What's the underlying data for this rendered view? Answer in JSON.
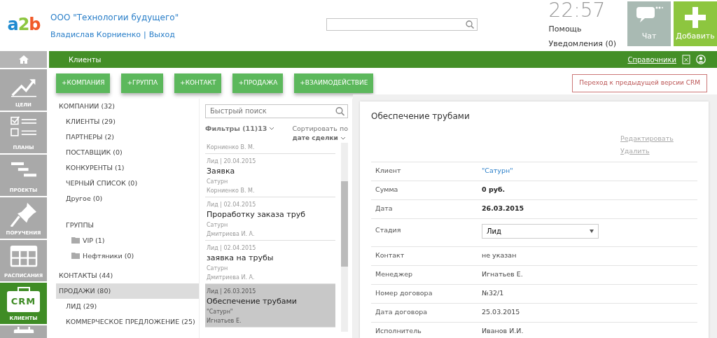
{
  "header": {
    "logo": "a2b",
    "company": "ООО \"Технологии будущего\"",
    "user": "Владислав Корниенко",
    "separator": "|",
    "logout": "Выход",
    "time": "22:57",
    "help": "Помощь",
    "notifications": "Уведомления (0)",
    "chat": "Чат",
    "add": "Добавить"
  },
  "navbar": {
    "title": "Клиенты",
    "directories": "Справочники"
  },
  "rail": [
    {
      "kind": "goals",
      "label": "ЦЕЛИ",
      "selected": false
    },
    {
      "kind": "plans",
      "label": "ПЛАНЫ",
      "selected": false
    },
    {
      "kind": "projects",
      "label": "ПРОЕКТЫ",
      "selected": false
    },
    {
      "kind": "tasks",
      "label": "ПОРУЧЕНИЯ",
      "selected": false
    },
    {
      "kind": "schedule",
      "label": "РАСПИСАНИЯ",
      "selected": false
    },
    {
      "kind": "crm",
      "label": "КЛИЕНТЫ",
      "badge": "CRM",
      "selected": true
    },
    {
      "kind": "calendar",
      "selected": false
    }
  ],
  "actions": [
    "+КОМПАНИЯ",
    "+ГРУППА",
    "+КОНТАКТ",
    "+ПРОДАЖА",
    "+ВЗАИМОДЕЙСТВИЕ"
  ],
  "old_version": "Переход к предыдущей версии CRM",
  "tree": [
    {
      "kind": "section",
      "label": "КОМПАНИИ (32)",
      "selected": false
    },
    {
      "kind": "item",
      "label": "КЛИЕНТЫ (29)",
      "selected": false
    },
    {
      "kind": "item",
      "label": "ПАРТНЕРЫ (2)",
      "selected": false
    },
    {
      "kind": "item",
      "label": "ПОСТАВЩИК (0)",
      "selected": false
    },
    {
      "kind": "item",
      "label": "КОНКУРЕНТЫ (1)",
      "selected": false
    },
    {
      "kind": "item",
      "label": "ЧЕРНЫЙ СПИСОК (0)",
      "selected": false
    },
    {
      "kind": "item",
      "label": "Другое (0)",
      "selected": false
    },
    {
      "kind": "group-heading",
      "label": "ГРУППЫ",
      "selected": false
    },
    {
      "kind": "folder",
      "label": "VIP (1)",
      "selected": false
    },
    {
      "kind": "folder",
      "label": "Нефтяники (0)",
      "selected": false
    },
    {
      "kind": "section",
      "label": "КОНТАКТЫ (44)",
      "selected": false
    },
    {
      "kind": "section",
      "label": "ПРОДАЖИ (80)",
      "selected": true
    },
    {
      "kind": "item",
      "label": "ЛИД (29)",
      "selected": false
    },
    {
      "kind": "item",
      "label": "КОММЕРЧЕСКОЕ ПРЕДЛОЖЕНИЕ (25)",
      "selected": false
    }
  ],
  "deals": {
    "search": {
      "placeholder": "Быстрый поиск"
    },
    "filters": "Фильтры (11)13",
    "sort_label": "Сортировать по",
    "sort_value": "дате сделки",
    "partial_top": "Корниенко В. М.",
    "items": [
      {
        "meta": "Лид | 20.04.2015",
        "title": "Заявка",
        "client": "Сатурн",
        "manager": "Корниенко В. М.",
        "selected": false
      },
      {
        "meta": "Лид | 02.04.2015",
        "title": "Проработку заказа труб",
        "client": "Сатурн",
        "manager": "Дмитриева И. А.",
        "selected": false
      },
      {
        "meta": "Лид | 02.04.2015",
        "title": "заявка на трубы",
        "client": "Сатурн",
        "manager": "Дмитриева И. А.",
        "selected": false
      },
      {
        "meta": "Лид | 26.03.2015",
        "title": "Обеспечение трубами",
        "client": "\"Сатурн\"",
        "manager": "Игнатьев Е.",
        "selected": true
      }
    ]
  },
  "detail": {
    "title": "Обеспечение трубами",
    "edit": "Редактировать",
    "delete": "Удалить",
    "rows": [
      {
        "kind": "link",
        "label": "Клиент",
        "value": "\"Сатурн\""
      },
      {
        "kind": "bold",
        "label": "Сумма",
        "value": "0 руб."
      },
      {
        "kind": "bold",
        "label": "Дата",
        "value": "26.03.2015"
      },
      {
        "kind": "select",
        "label": "Стадия",
        "value": "Лид"
      },
      {
        "kind": "plain",
        "label": "Контакт",
        "value": "не указан"
      },
      {
        "kind": "plain",
        "label": "Менеджер",
        "value": "Игнатьев Е."
      },
      {
        "kind": "plain",
        "label": "Номер договора",
        "value": "№32/1"
      },
      {
        "kind": "plain",
        "label": "Дата договора",
        "value": "25.03.2015"
      },
      {
        "kind": "plain",
        "label": "Исполнитель",
        "value": "Иванов И.И."
      }
    ]
  }
}
